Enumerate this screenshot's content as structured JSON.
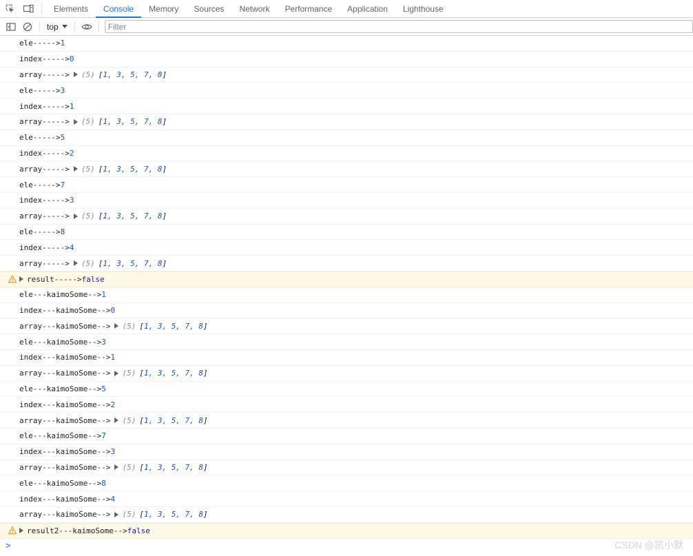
{
  "devtools": {
    "left_icons": [
      {
        "name": "inspect-element-icon",
        "title": "Inspect element"
      },
      {
        "name": "device-toolbar-icon",
        "title": "Toggle device toolbar"
      }
    ],
    "tabs": [
      {
        "label": "Elements",
        "active": false
      },
      {
        "label": "Console",
        "active": true
      },
      {
        "label": "Memory",
        "active": false
      },
      {
        "label": "Sources",
        "active": false
      },
      {
        "label": "Network",
        "active": false
      },
      {
        "label": "Performance",
        "active": false
      },
      {
        "label": "Application",
        "active": false
      },
      {
        "label": "Lighthouse",
        "active": false
      }
    ],
    "active_tab_color": "#1a73e8"
  },
  "console_toolbar": {
    "sidebar_toggle_icon": "show-console-sidebar-icon",
    "clear_icon": "clear-console-icon",
    "context_value": "top",
    "eye_icon": "create-live-expression-icon",
    "filter": {
      "value": "",
      "placeholder": "Filter"
    }
  },
  "console": {
    "rows": [
      {
        "type": "log",
        "label": "ele----->",
        "value": "1",
        "kind": "number"
      },
      {
        "type": "log",
        "label": "index----->",
        "value": "0",
        "kind": "number"
      },
      {
        "type": "log",
        "label": "array----->",
        "kind": "array",
        "length": "(5)",
        "array": "[1, 3, 5, 7, 8]"
      },
      {
        "type": "log",
        "label": "ele----->",
        "value": "3",
        "kind": "number"
      },
      {
        "type": "log",
        "label": "index----->",
        "value": "1",
        "kind": "number"
      },
      {
        "type": "log",
        "label": "array----->",
        "kind": "array",
        "length": "(5)",
        "array": "[1, 3, 5, 7, 8]"
      },
      {
        "type": "log",
        "label": "ele----->",
        "value": "5",
        "kind": "number"
      },
      {
        "type": "log",
        "label": "index----->",
        "value": "2",
        "kind": "number"
      },
      {
        "type": "log",
        "label": "array----->",
        "kind": "array",
        "length": "(5)",
        "array": "[1, 3, 5, 7, 8]"
      },
      {
        "type": "log",
        "label": "ele----->",
        "value": "7",
        "kind": "number"
      },
      {
        "type": "log",
        "label": "index----->",
        "value": "3",
        "kind": "number"
      },
      {
        "type": "log",
        "label": "array----->",
        "kind": "array",
        "length": "(5)",
        "array": "[1, 3, 5, 7, 8]"
      },
      {
        "type": "log",
        "label": "ele----->",
        "value": "8",
        "kind": "number"
      },
      {
        "type": "log",
        "label": "index----->",
        "value": "4",
        "kind": "number"
      },
      {
        "type": "log",
        "label": "array----->",
        "kind": "array",
        "length": "(5)",
        "array": "[1, 3, 5, 7, 8]"
      },
      {
        "type": "warning",
        "label": "result----->",
        "value": "false",
        "kind": "boolean",
        "expandable": true
      },
      {
        "type": "log",
        "label": "ele---kaimoSome-->",
        "value": "1",
        "kind": "number"
      },
      {
        "type": "log",
        "label": "index---kaimoSome-->",
        "value": "0",
        "kind": "number"
      },
      {
        "type": "log",
        "label": "array---kaimoSome-->",
        "kind": "array",
        "length": "(5)",
        "array": "[1, 3, 5, 7, 8]"
      },
      {
        "type": "log",
        "label": "ele---kaimoSome-->",
        "value": "3",
        "kind": "number"
      },
      {
        "type": "log",
        "label": "index---kaimoSome-->",
        "value": "1",
        "kind": "number"
      },
      {
        "type": "log",
        "label": "array---kaimoSome-->",
        "kind": "array",
        "length": "(5)",
        "array": "[1, 3, 5, 7, 8]"
      },
      {
        "type": "log",
        "label": "ele---kaimoSome-->",
        "value": "5",
        "kind": "number"
      },
      {
        "type": "log",
        "label": "index---kaimoSome-->",
        "value": "2",
        "kind": "number"
      },
      {
        "type": "log",
        "label": "array---kaimoSome-->",
        "kind": "array",
        "length": "(5)",
        "array": "[1, 3, 5, 7, 8]"
      },
      {
        "type": "log",
        "label": "ele---kaimoSome-->",
        "value": "7",
        "kind": "number"
      },
      {
        "type": "log",
        "label": "index---kaimoSome-->",
        "value": "3",
        "kind": "number"
      },
      {
        "type": "log",
        "label": "array---kaimoSome-->",
        "kind": "array",
        "length": "(5)",
        "array": "[1, 3, 5, 7, 8]"
      },
      {
        "type": "log",
        "label": "ele---kaimoSome-->",
        "value": "8",
        "kind": "number"
      },
      {
        "type": "log",
        "label": "index---kaimoSome-->",
        "value": "4",
        "kind": "number"
      },
      {
        "type": "log",
        "label": "array---kaimoSome-->",
        "kind": "array",
        "length": "(5)",
        "array": "[1, 3, 5, 7, 8]"
      },
      {
        "type": "warning",
        "label": "result2---kaimoSome-->",
        "value": "false",
        "kind": "boolean",
        "expandable": true
      }
    ],
    "prompt_symbol": ">",
    "warning_bg": "#fdf9e7",
    "warning_icon": "warning-triangle-icon",
    "number_color": "#1155cc",
    "boolean_color": "#1a1aa6"
  },
  "watermark": {
    "text": "CSDN @凯小默"
  }
}
